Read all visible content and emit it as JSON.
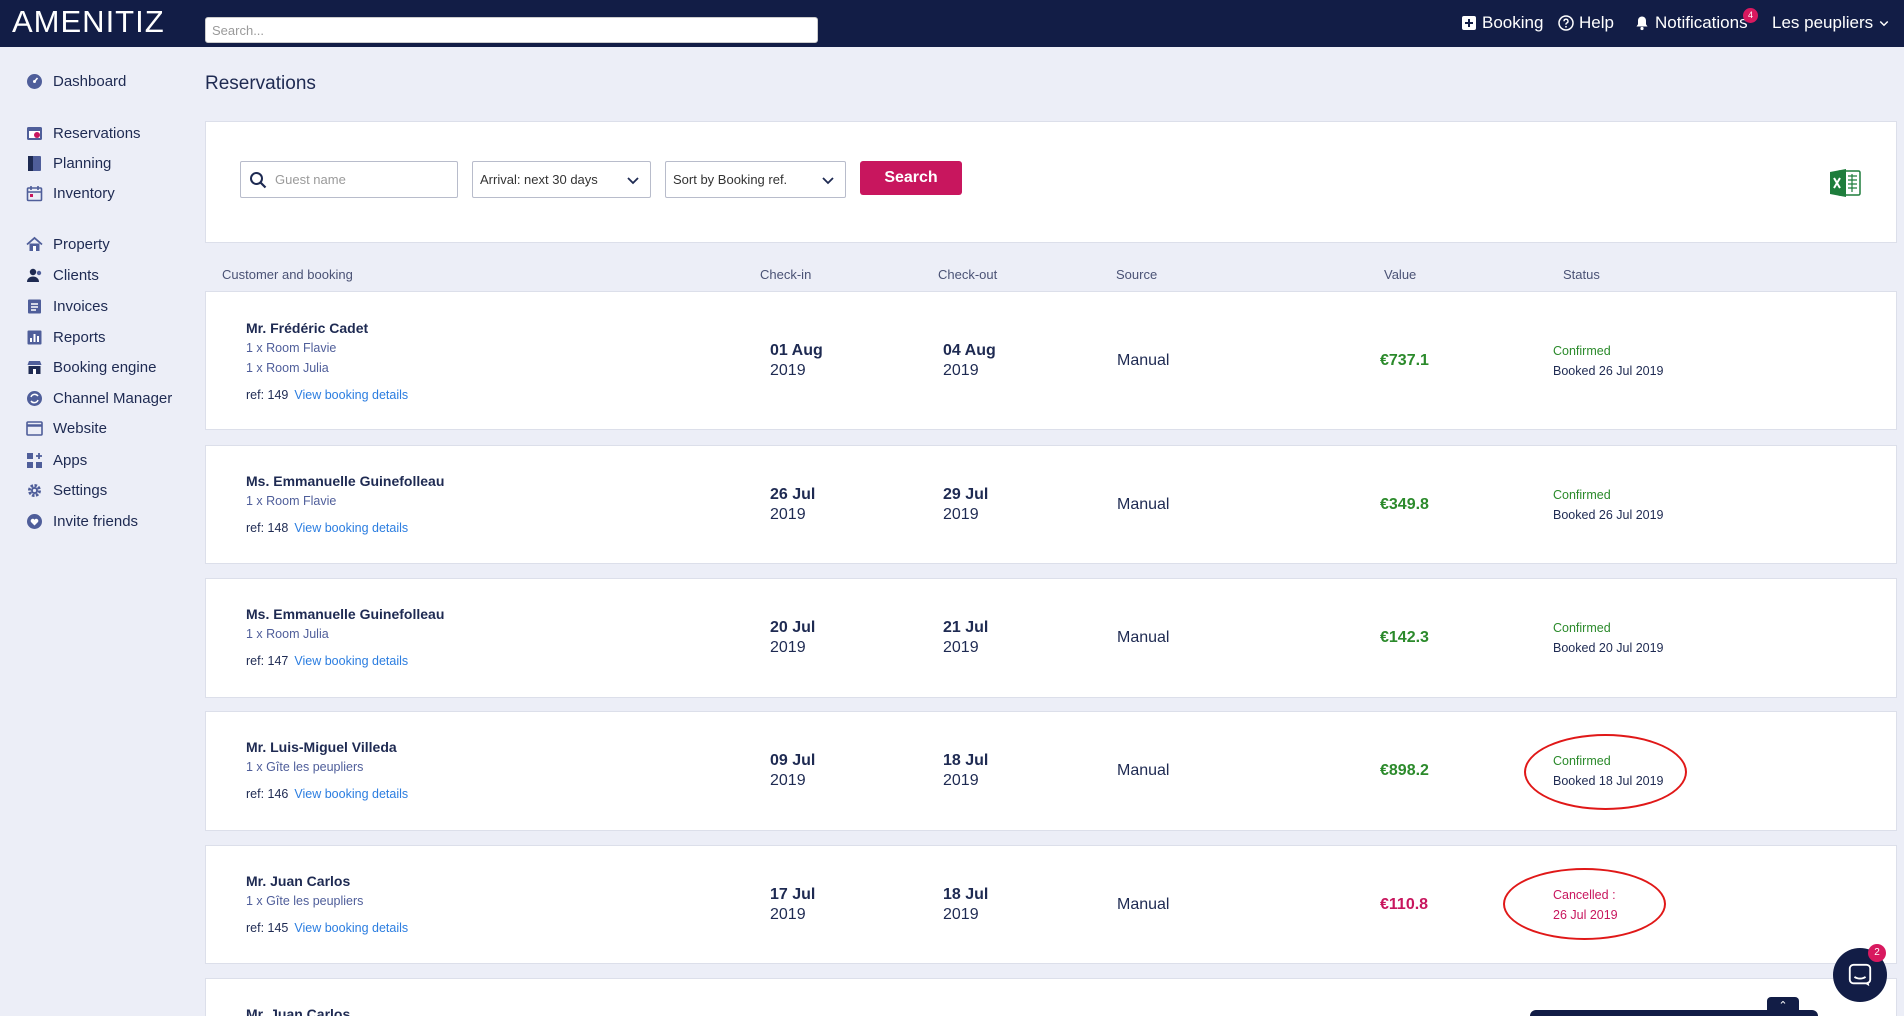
{
  "app": {
    "logo": "AMENITIZ"
  },
  "topbar": {
    "search_placeholder": "Search...",
    "booking_label": "Booking",
    "help_label": "Help",
    "notifications_label": "Notifications",
    "notifications_count": "4",
    "property_name": "Les peupliers"
  },
  "sidebar": {
    "items": [
      {
        "label": "Dashboard",
        "icon": "dashboard-icon"
      },
      {
        "label": "Reservations",
        "icon": "reservations-icon"
      },
      {
        "label": "Planning",
        "icon": "planning-icon"
      },
      {
        "label": "Inventory",
        "icon": "inventory-icon"
      },
      {
        "label": "Property",
        "icon": "home-icon"
      },
      {
        "label": "Clients",
        "icon": "clients-icon"
      },
      {
        "label": "Invoices",
        "icon": "invoices-icon"
      },
      {
        "label": "Reports",
        "icon": "reports-icon"
      },
      {
        "label": "Booking engine",
        "icon": "booking-engine-icon"
      },
      {
        "label": "Channel Manager",
        "icon": "channel-manager-icon"
      },
      {
        "label": "Website",
        "icon": "website-icon"
      },
      {
        "label": "Apps",
        "icon": "apps-icon"
      },
      {
        "label": "Settings",
        "icon": "gear-icon"
      },
      {
        "label": "Invite friends",
        "icon": "heart-icon"
      }
    ]
  },
  "page": {
    "title": "Reservations"
  },
  "filters": {
    "guest_placeholder": "Guest name",
    "arrival_value": "Arrival: next 30 days",
    "sort_value": "Sort by Booking ref.",
    "search_label": "Search"
  },
  "columns": {
    "customer": "Customer and booking",
    "checkin": "Check-in",
    "checkout": "Check-out",
    "source": "Source",
    "value": "Value",
    "status": "Status"
  },
  "colors": {
    "topbar": "#121d46",
    "accent": "#c8165e",
    "confirmed": "#2b8a2b",
    "cancelled": "#c8165e",
    "link": "#2b7de0"
  },
  "reservations": [
    {
      "name": "Mr. Frédéric Cadet",
      "rooms": [
        "1 x Room Flavie",
        "1 x Room Julia"
      ],
      "ref": "ref: 149",
      "details_link": "View booking details",
      "checkin_day": "01 Aug",
      "checkin_year": "2019",
      "checkout_day": "04 Aug",
      "checkout_year": "2019",
      "source": "Manual",
      "value": "€737.1",
      "status": "Confirmed",
      "status_detail": "Booked 26 Jul 2019"
    },
    {
      "name": "Ms. Emmanuelle Guinefolleau",
      "rooms": [
        "1 x Room Flavie"
      ],
      "ref": "ref: 148",
      "details_link": "View booking details",
      "checkin_day": "26 Jul",
      "checkin_year": "2019",
      "checkout_day": "29 Jul",
      "checkout_year": "2019",
      "source": "Manual",
      "value": "€349.8",
      "status": "Confirmed",
      "status_detail": "Booked 26 Jul 2019"
    },
    {
      "name": "Ms. Emmanuelle Guinefolleau",
      "rooms": [
        "1 x Room Julia"
      ],
      "ref": "ref: 147",
      "details_link": "View booking details",
      "checkin_day": "20 Jul",
      "checkin_year": "2019",
      "checkout_day": "21 Jul",
      "checkout_year": "2019",
      "source": "Manual",
      "value": "€142.3",
      "status": "Confirmed",
      "status_detail": "Booked 20 Jul 2019"
    },
    {
      "name": "Mr. Luis-Miguel Villeda",
      "rooms": [
        "1 x Gîte les peupliers"
      ],
      "ref": "ref: 146",
      "details_link": "View booking details",
      "checkin_day": "09 Jul",
      "checkin_year": "2019",
      "checkout_day": "18 Jul",
      "checkout_year": "2019",
      "source": "Manual",
      "value": "€898.2",
      "status": "Confirmed",
      "status_detail": "Booked 18 Jul 2019"
    },
    {
      "name": "Mr. Juan Carlos",
      "rooms": [
        "1 x Gîte les peupliers"
      ],
      "ref": "ref: 145",
      "details_link": "View booking details",
      "checkin_day": "17 Jul",
      "checkin_year": "2019",
      "checkout_day": "18 Jul",
      "checkout_year": "2019",
      "source": "Manual",
      "value": "€110.8",
      "status": "Cancelled :",
      "status_detail": "26 Jul 2019"
    },
    {
      "name": "Mr. Juan Carlos"
    }
  ],
  "chat": {
    "badge": "2"
  }
}
